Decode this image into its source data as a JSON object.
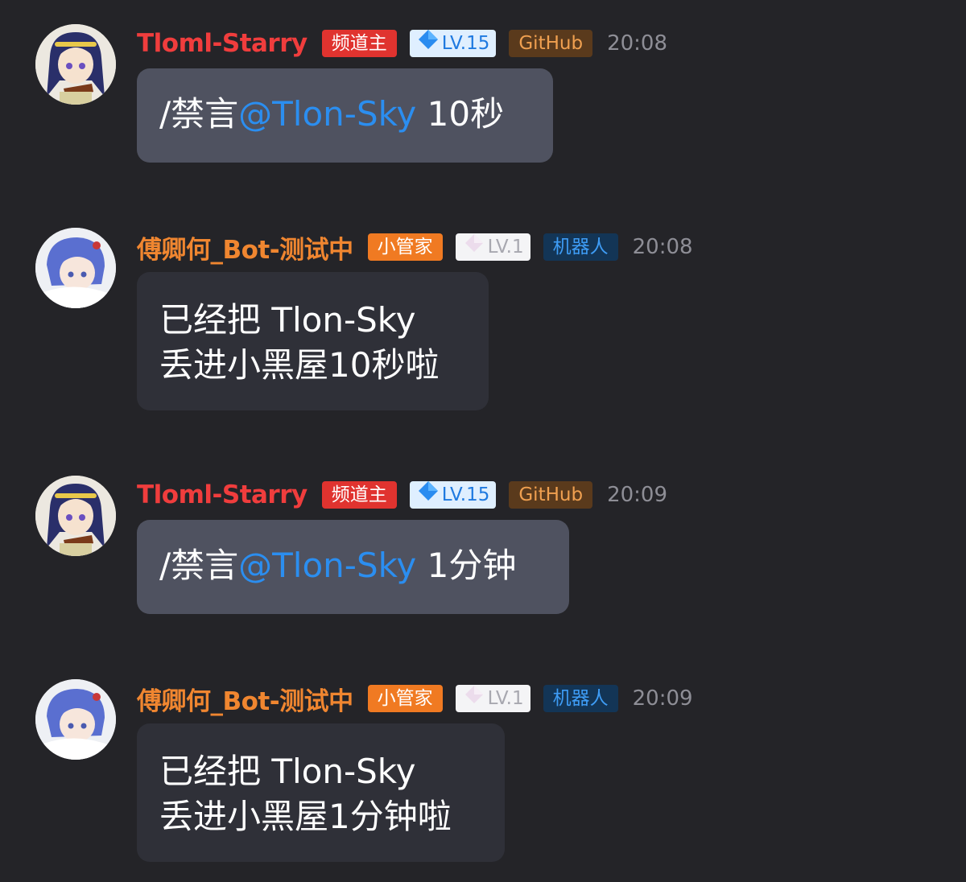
{
  "colors": {
    "background": "#242428",
    "user_name": "#f03d3d",
    "bot_name": "#f08630",
    "mention": "#2b8ef0",
    "user_bubble": "#4f5260",
    "bot_bubble": "#2f3038"
  },
  "messages": [
    {
      "sender": "Tloml-Starry",
      "role_badge": "频道主",
      "level_badge": "LV.15",
      "tag_badge": "GitHub",
      "time": "20:08",
      "command": "/禁言",
      "mention": "@Tlon-Sky",
      "argument": " 10秒"
    },
    {
      "sender": "傅卿何_Bot-测试中",
      "role_badge": "小管家",
      "level_badge": "LV.1",
      "tag_badge": "机器人",
      "time": "20:08",
      "line1": "已经把 Tlon-Sky",
      "line2": "丢进小黑屋10秒啦"
    },
    {
      "sender": "Tloml-Starry",
      "role_badge": "频道主",
      "level_badge": "LV.15",
      "tag_badge": "GitHub",
      "time": "20:09",
      "command": "/禁言",
      "mention": "@Tlon-Sky",
      "argument": " 1分钟"
    },
    {
      "sender": "傅卿何_Bot-测试中",
      "role_badge": "小管家",
      "level_badge": "LV.1",
      "tag_badge": "机器人",
      "time": "20:09",
      "line1": "已经把 Tlon-Sky",
      "line2": "丢进小黑屋1分钟啦"
    }
  ]
}
